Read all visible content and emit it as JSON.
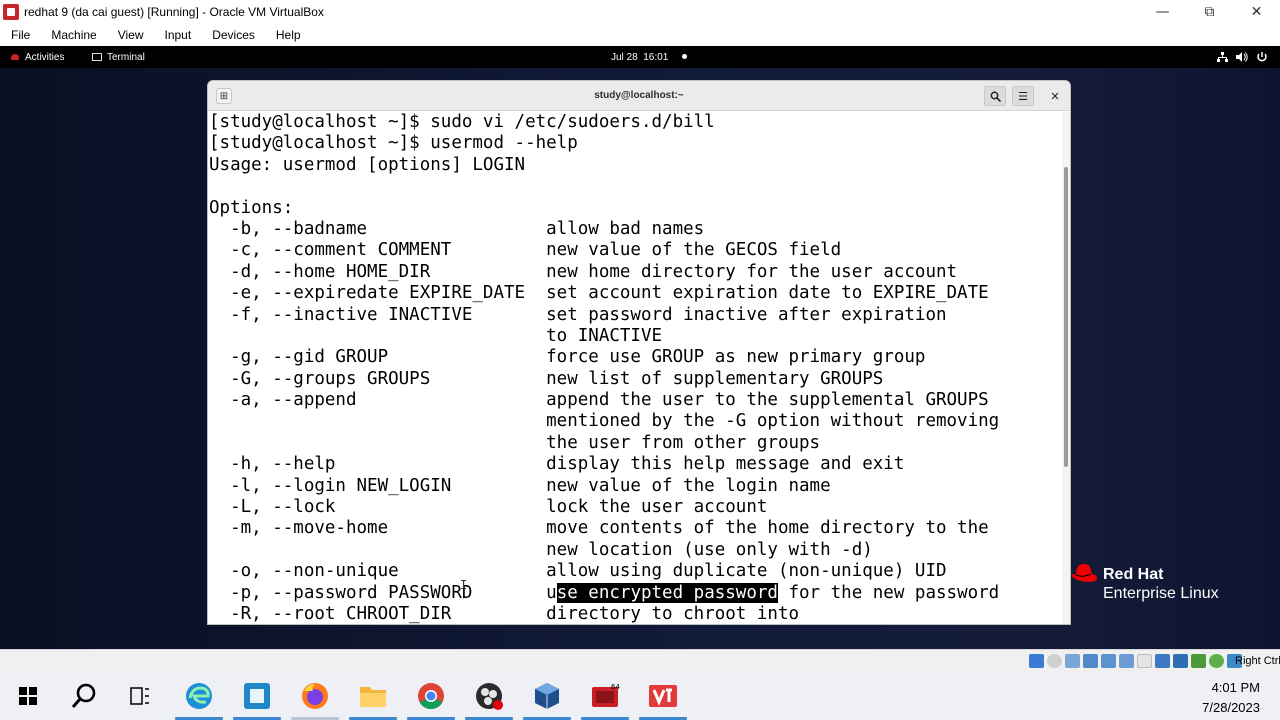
{
  "host_window": {
    "title": "redhat 9 (da cai guest) [Running] - Oracle VM VirtualBox",
    "menu": [
      "File",
      "Machine",
      "View",
      "Input",
      "Devices",
      "Help"
    ]
  },
  "gnome": {
    "activities": "Activities",
    "app_name": "Terminal",
    "clock": "Jul 28  16:01"
  },
  "terminal": {
    "title": "study@localhost:~",
    "lines": [
      "[study@localhost ~]$ sudo vi /etc/sudoers.d/bill",
      "[study@localhost ~]$ usermod --help",
      "Usage: usermod [options] LOGIN",
      "",
      "Options:",
      "  -b, --badname                 allow bad names",
      "  -c, --comment COMMENT         new value of the GECOS field",
      "  -d, --home HOME_DIR           new home directory for the user account",
      "  -e, --expiredate EXPIRE_DATE  set account expiration date to EXPIRE_DATE",
      "  -f, --inactive INACTIVE       set password inactive after expiration",
      "                                to INACTIVE",
      "  -g, --gid GROUP               force use GROUP as new primary group",
      "  -G, --groups GROUPS           new list of supplementary GROUPS",
      "  -a, --append                  append the user to the supplemental GROUPS",
      "                                mentioned by the -G option without removing",
      "                                the user from other groups",
      "  -h, --help                    display this help message and exit",
      "  -l, --login NEW_LOGIN         new value of the login name",
      "  -L, --lock                    lock the user account",
      "  -m, --move-home               move contents of the home directory to the",
      "                                new location (use only with -d)",
      "  -o, --non-unique              allow using duplicate (non-unique) UID"
    ],
    "password_line": {
      "before": "  -p, --password PASSWORD       u",
      "highlight": "se encrypted password",
      "after": " for the new password"
    },
    "last_line": "  -R, --root CHROOT_DIR         directory to chroot into"
  },
  "branding": {
    "name": "Red Hat",
    "subtitle": "Enterprise Linux"
  },
  "statusbar": {
    "host_key": "Right Ctrl"
  },
  "taskbar": {
    "time": "4:01 PM",
    "date": "7/28/2023",
    "icons": [
      "windows-start-icon",
      "search-icon",
      "task-view-icon",
      "edge-icon",
      "app-icon",
      "firefox-icon",
      "file-explorer-icon",
      "chrome-icon",
      "obs-icon",
      "virtualbox-icon",
      "virtualbox-vm-icon",
      "vb-app-icon"
    ]
  },
  "colors": {
    "redhat_red": "#ee0000",
    "taskbar_bg": "#eef0f5",
    "highlight": "#000000"
  }
}
